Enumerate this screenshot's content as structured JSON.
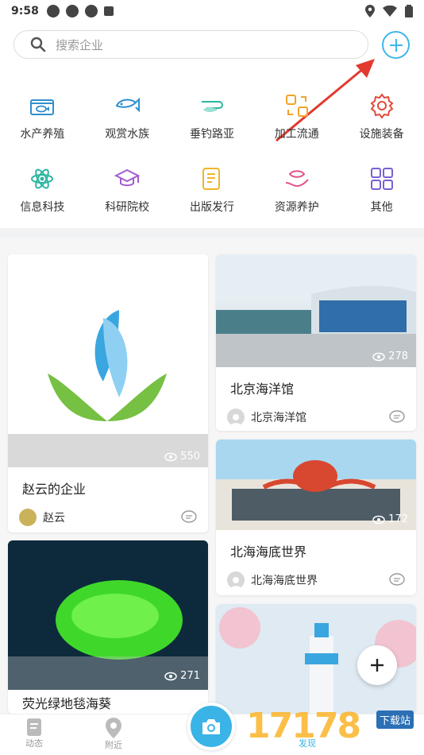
{
  "status": {
    "time": "9:58"
  },
  "search": {
    "placeholder": "搜索企业"
  },
  "categories": [
    {
      "label": "水产养殖",
      "icon": "aquaculture-icon"
    },
    {
      "label": "观赏水族",
      "icon": "ornamental-fish-icon"
    },
    {
      "label": "垂钓路亚",
      "icon": "fishing-icon"
    },
    {
      "label": "加工流通",
      "icon": "processing-icon"
    },
    {
      "label": "设施装备",
      "icon": "gear-icon"
    },
    {
      "label": "信息科技",
      "icon": "atom-icon"
    },
    {
      "label": "科研院校",
      "icon": "graduation-cap-icon"
    },
    {
      "label": "出版发行",
      "icon": "publication-icon"
    },
    {
      "label": "资源养护",
      "icon": "fish-care-icon"
    },
    {
      "label": "其他",
      "icon": "grid-icon"
    }
  ],
  "cards": [
    {
      "title": "赵云的企业",
      "author": "赵云",
      "views": "550"
    },
    {
      "title": "北京海洋馆",
      "author": "北京海洋馆",
      "views": "278"
    },
    {
      "title": "北海海底世界",
      "author": "北海海底世界",
      "views": "172"
    },
    {
      "title": "荧光绿地毯海葵",
      "views": "271"
    }
  ],
  "bottom_nav": {
    "tab1": "动态",
    "tab2": "附近",
    "tab3": "发现"
  },
  "watermark": {
    "text": "17178",
    "badge": "下载站"
  },
  "colors": {
    "accent": "#3ab3e6"
  }
}
